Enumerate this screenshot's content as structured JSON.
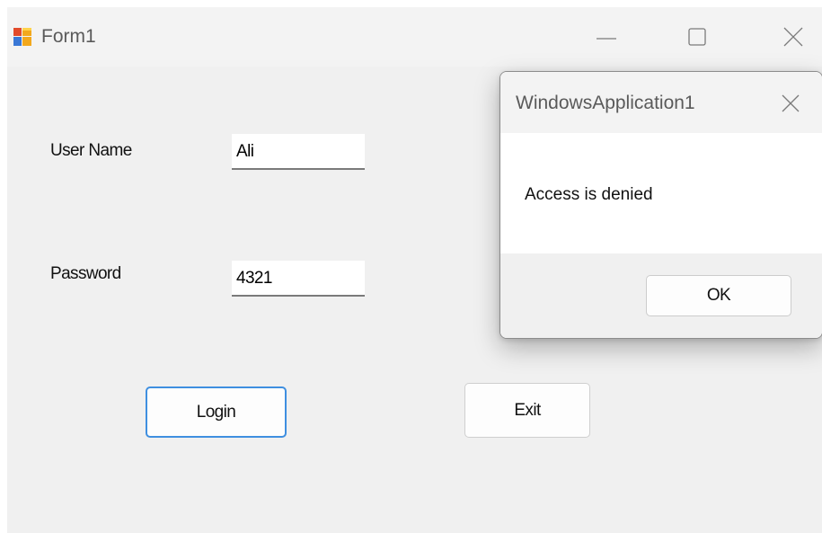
{
  "window": {
    "title": "Form1",
    "controls": {
      "minimize": "minimize-icon",
      "maximize": "maximize-icon",
      "close": "close-icon"
    }
  },
  "form": {
    "username_label": "User Name",
    "username_value": "Ali",
    "password_label": "Password",
    "password_value": "4321",
    "login_label": "Login",
    "exit_label": "Exit"
  },
  "dialog": {
    "title": "WindowsApplication1",
    "message": "Access is denied",
    "ok_label": "OK"
  },
  "colors": {
    "focus_border": "#3f8fe0",
    "window_background": "#f0f0f0"
  }
}
